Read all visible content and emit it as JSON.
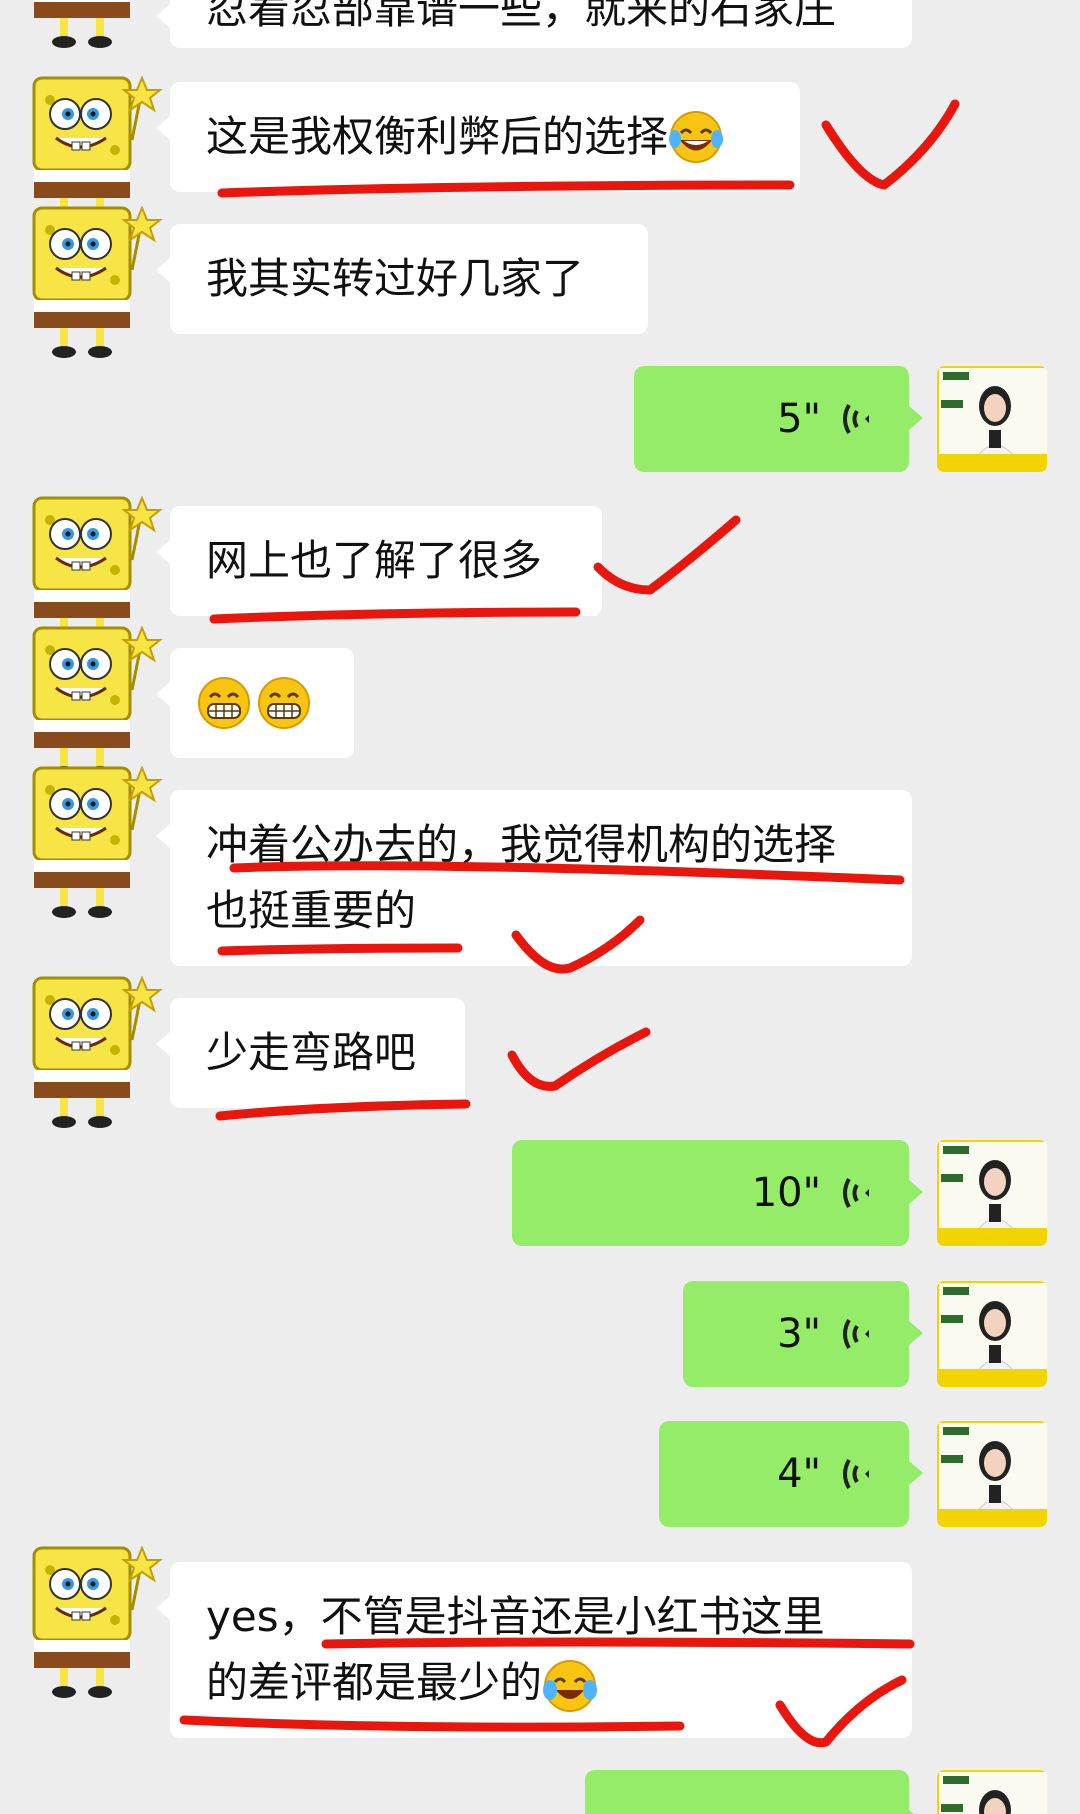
{
  "messages": {
    "m0": "忍着忍部靠谱一些，就来的石家庄",
    "m1": "这是我权衡利弊后的选择",
    "m2": "我其实转过好几家了",
    "v1": "5\"",
    "m3": "网上也了解了很多",
    "m5_line1": "冲着公办去的，我觉得机构的选择",
    "m5_line2": "也挺重要的",
    "m6": "少走弯路吧",
    "v2": "10\"",
    "v3": "3\"",
    "v4": "4\"",
    "m7_line1": "yes，不管是抖音还是小红书这里",
    "m7_line2": "的差评都是最少的"
  },
  "colors": {
    "background": "#ededed",
    "sent_bubble": "#95ec69",
    "received_bubble": "#ffffff",
    "annotation": "#e8160c"
  },
  "icons": {
    "received_avatar": "spongebob-avatar",
    "sent_avatar": "teacher-avatar",
    "voice": "voice-wave-icon"
  }
}
